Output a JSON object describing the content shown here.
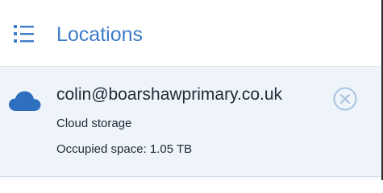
{
  "header": {
    "title": "Locations",
    "menu_icon": "list-menu-icon"
  },
  "location": {
    "icon": "cloud-icon",
    "account": "colin@boarshawprimary.co.uk",
    "type": "Cloud storage",
    "occupied": "Occupied space: 1.05 TB",
    "remove_icon": "close-circle-icon"
  },
  "colors": {
    "accent": "#3d7cc9",
    "item_background": "#eef4fa",
    "text": "#1f2a36",
    "remove_icon": "#a9c3e0"
  }
}
